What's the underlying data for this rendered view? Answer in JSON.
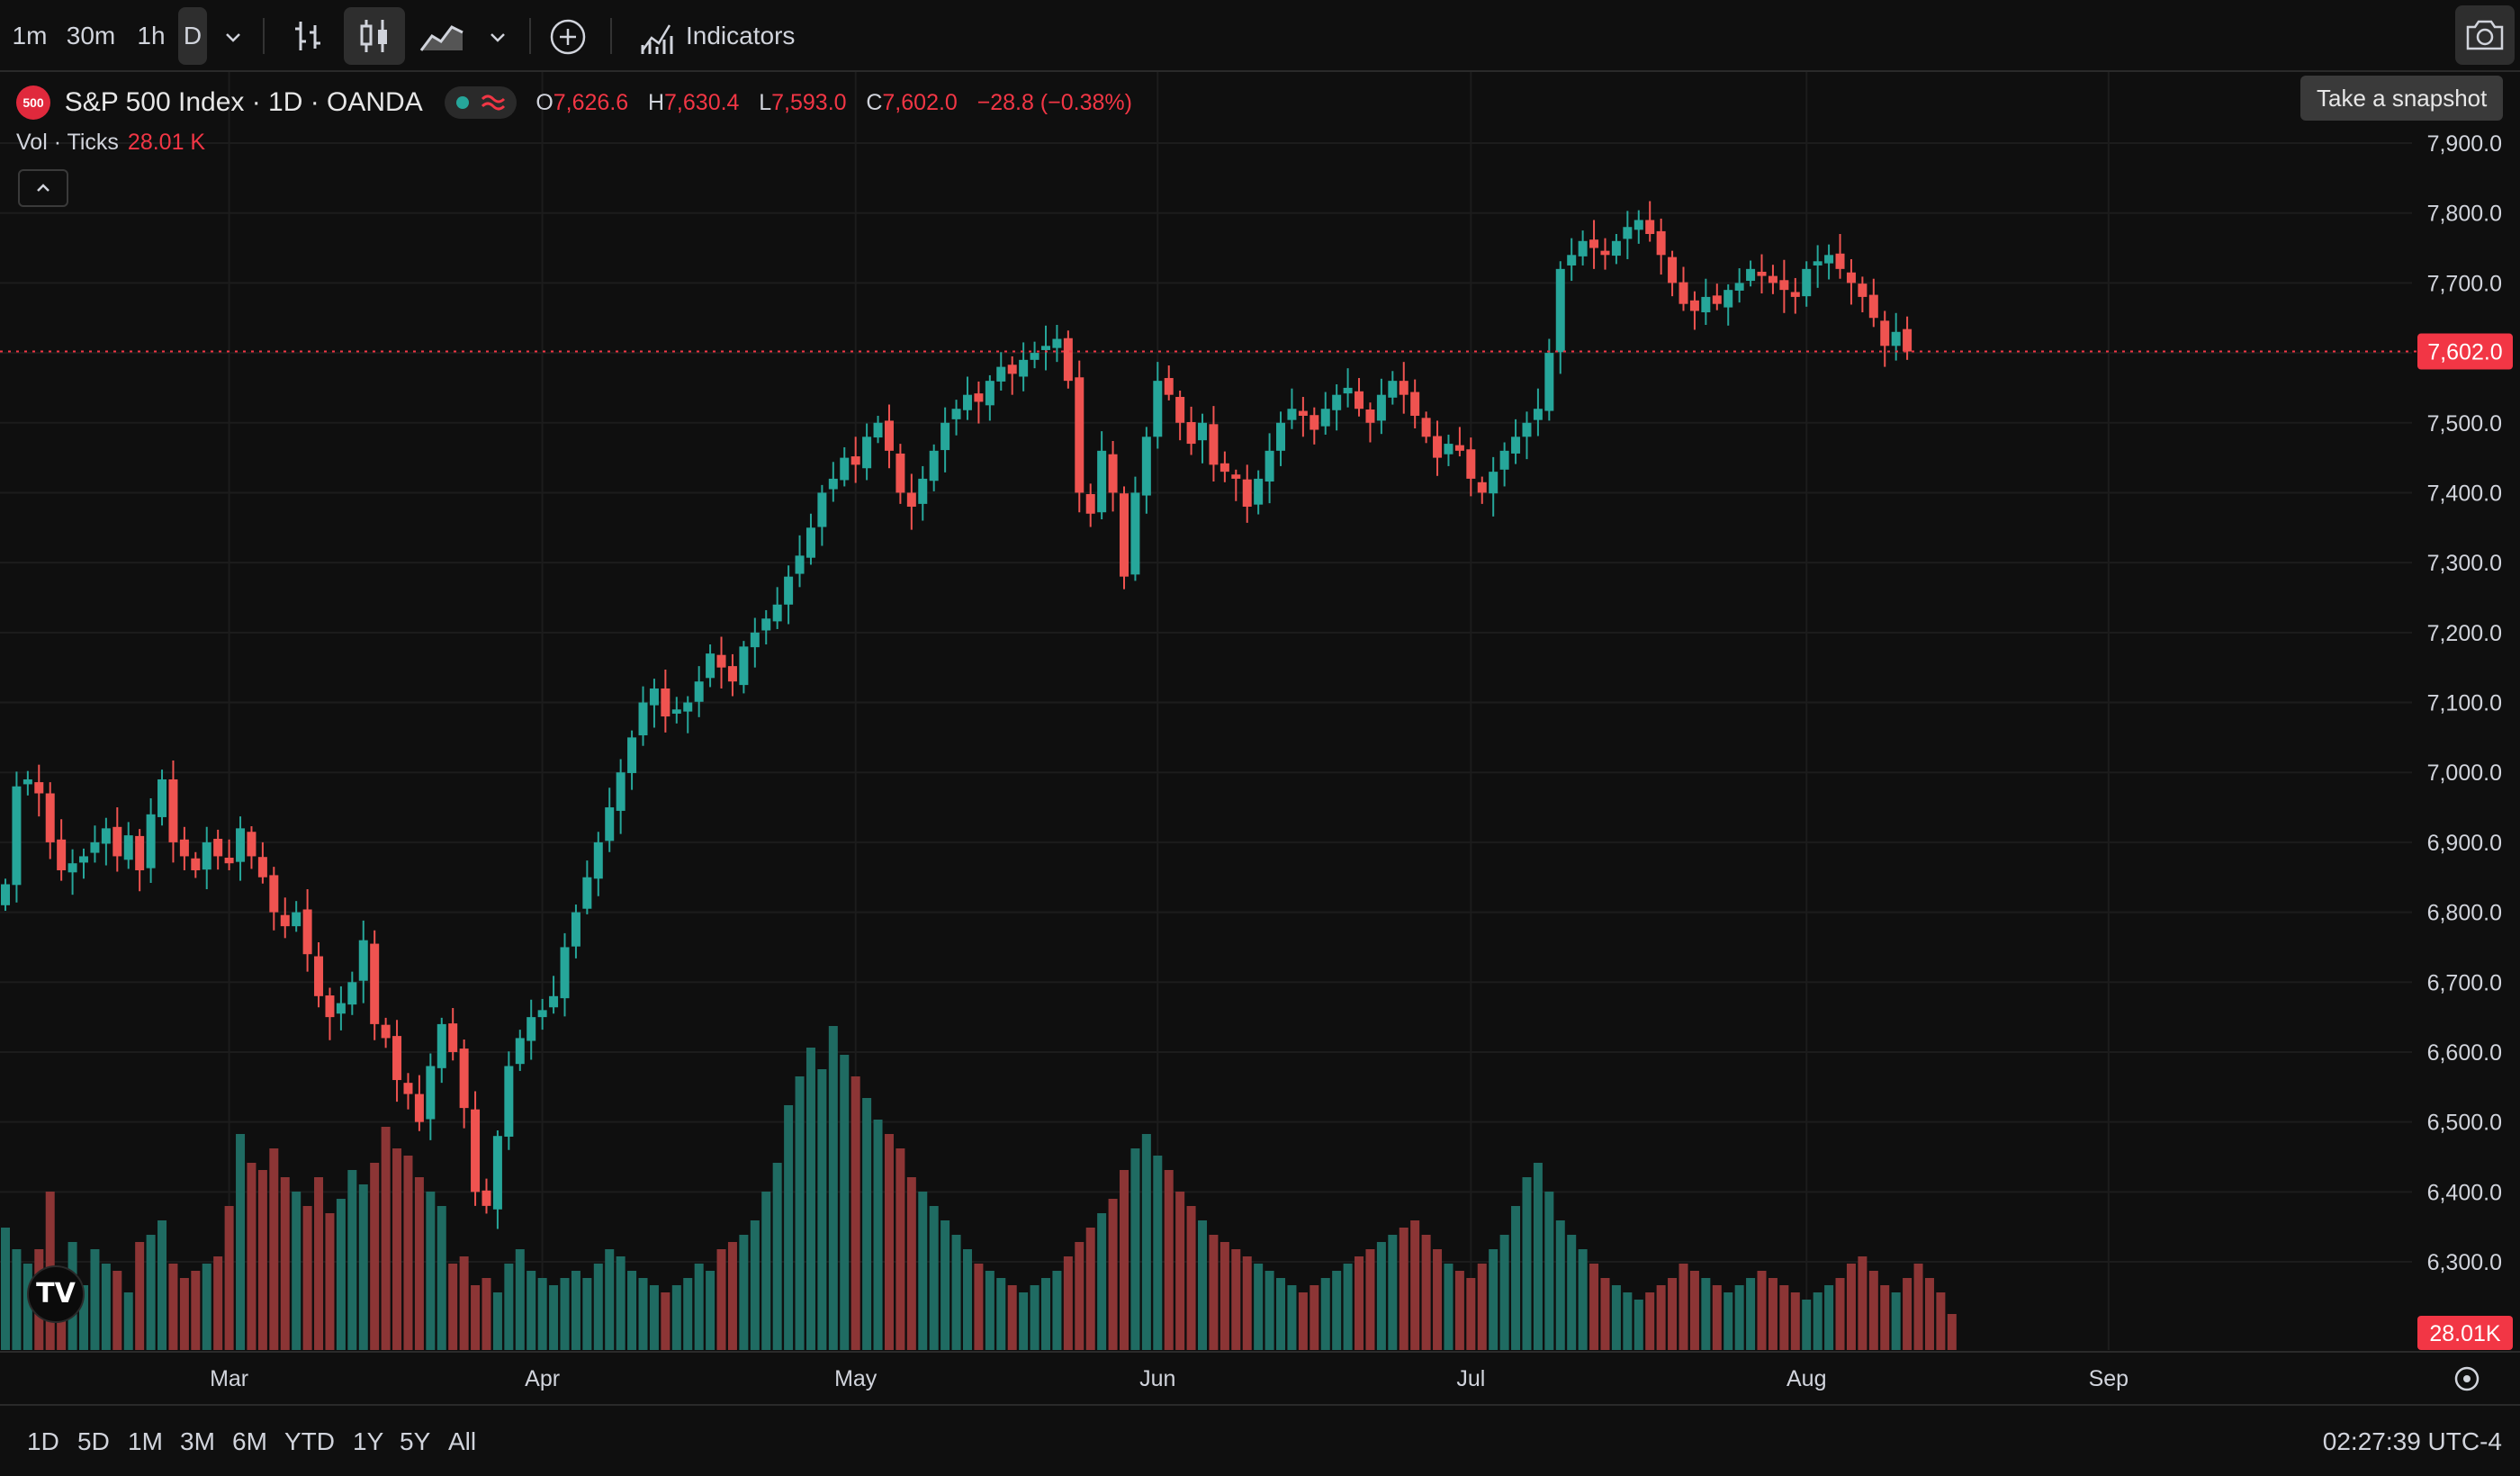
{
  "toolbar": {
    "intervals": [
      "1m",
      "30m",
      "1h",
      "D"
    ],
    "active_interval": "D",
    "indicators_label": "Indicators",
    "snapshot_tooltip": "Take a snapshot"
  },
  "legend": {
    "logo_text": "500",
    "title": "S&P 500 Index · 1D · OANDA",
    "o_key": "O",
    "o_val": "7,626.6",
    "h_key": "H",
    "h_val": "7,630.4",
    "l_key": "L",
    "l_val": "7,593.0",
    "c_key": "C",
    "c_val": "7,602.0",
    "change": "−28.8 (−0.38%)",
    "vol_label": "Vol · Ticks",
    "vol_value": "28.01 K"
  },
  "bottom": {
    "ranges": [
      "1D",
      "5D",
      "1M",
      "3M",
      "6M",
      "YTD",
      "1Y",
      "5Y",
      "All"
    ],
    "clock": "02:27:39 UTC-4"
  },
  "colors": {
    "up": "#26a69a",
    "down": "#ef5350",
    "up_vol": "#1f6b62",
    "down_vol": "#8c3535",
    "last_price": "#f23645"
  },
  "chart_data": {
    "type": "candlestick",
    "title": "S&P 500 Index · 1D · OANDA",
    "y_ticks": [
      "6,300.0",
      "6,400.0",
      "6,500.0",
      "6,600.0",
      "6,700.0",
      "6,800.0",
      "6,900.0",
      "7,000.0",
      "7,100.0",
      "7,200.0",
      "7,300.0",
      "7,400.0",
      "7,500.0",
      "7,600.0",
      "7,700.0",
      "7,800.0",
      "7,900.0"
    ],
    "y_tick_values": [
      6300,
      6400,
      6500,
      6600,
      6700,
      6800,
      6900,
      7000,
      7100,
      7200,
      7300,
      7400,
      7500,
      7600,
      7700,
      7800,
      7900
    ],
    "x_ticks": [
      {
        "label": "Mar",
        "index": 20
      },
      {
        "label": "Apr",
        "index": 48
      },
      {
        "label": "May",
        "index": 76
      },
      {
        "label": "Jun",
        "index": 103
      },
      {
        "label": "Jul",
        "index": 131
      },
      {
        "label": "Aug",
        "index": 161
      },
      {
        "label": "Sep",
        "index": 188
      }
    ],
    "last_price_label": "7,602.0",
    "last_price": 7602,
    "last_volume_label": "28.01K",
    "closes": [
      6840,
      6980,
      6990,
      6970,
      6900,
      6860,
      6870,
      6880,
      6900,
      6920,
      6880,
      6910,
      6860,
      6940,
      6990,
      6900,
      6880,
      6860,
      6900,
      6880,
      6870,
      6920,
      6880,
      6850,
      6800,
      6780,
      6800,
      6740,
      6680,
      6650,
      6670,
      6700,
      6760,
      6640,
      6620,
      6560,
      6540,
      6500,
      6580,
      6640,
      6600,
      6520,
      6400,
      6380,
      6480,
      6580,
      6620,
      6650,
      6660,
      6680,
      6750,
      6800,
      6850,
      6900,
      6950,
      7000,
      7050,
      7100,
      7120,
      7080,
      7090,
      7100,
      7130,
      7170,
      7150,
      7130,
      7180,
      7200,
      7220,
      7240,
      7280,
      7310,
      7350,
      7400,
      7420,
      7450,
      7440,
      7480,
      7500,
      7460,
      7400,
      7380,
      7420,
      7460,
      7500,
      7520,
      7540,
      7530,
      7560,
      7580,
      7570,
      7590,
      7600,
      7610,
      7620,
      7560,
      7400,
      7370,
      7460,
      7400,
      7280,
      7400,
      7480,
      7560,
      7540,
      7500,
      7470,
      7500,
      7440,
      7430,
      7420,
      7380,
      7420,
      7460,
      7500,
      7520,
      7510,
      7490,
      7520,
      7540,
      7550,
      7520,
      7500,
      7540,
      7560,
      7540,
      7510,
      7480,
      7450,
      7470,
      7460,
      7420,
      7400,
      7430,
      7460,
      7480,
      7500,
      7520,
      7600,
      7720,
      7740,
      7760,
      7750,
      7740,
      7760,
      7780,
      7790,
      7770,
      7740,
      7700,
      7670,
      7660,
      7680,
      7670,
      7690,
      7700,
      7720,
      7710,
      7700,
      7690,
      7680,
      7720,
      7730,
      7740,
      7720,
      7700,
      7680,
      7650,
      7610,
      7630,
      7602
    ],
    "volumes": [
      17000,
      14000,
      12000,
      14000,
      22000,
      10000,
      15000,
      9000,
      14000,
      12000,
      11000,
      8000,
      15000,
      16000,
      18000,
      12000,
      10000,
      11000,
      12000,
      13000,
      20000,
      30000,
      26000,
      25000,
      28000,
      24000,
      22000,
      20000,
      24000,
      19000,
      21000,
      25000,
      23000,
      26000,
      31000,
      28000,
      27000,
      24000,
      22000,
      20000,
      12000,
      13000,
      9000,
      10000,
      8000,
      12000,
      14000,
      11000,
      10000,
      9000,
      10000,
      11000,
      10000,
      12000,
      14000,
      13000,
      11000,
      10000,
      9000,
      8000,
      9000,
      10000,
      12000,
      11000,
      14000,
      15000,
      16000,
      18000,
      22000,
      26000,
      34000,
      38000,
      42000,
      39000,
      45000,
      41000,
      38000,
      35000,
      32000,
      30000,
      28000,
      24000,
      22000,
      20000,
      18000,
      16000,
      14000,
      12000,
      11000,
      10000,
      9000,
      8000,
      9000,
      10000,
      11000,
      13000,
      15000,
      17000,
      19000,
      21000,
      25000,
      28000,
      30000,
      27000,
      25000,
      22000,
      20000,
      18000,
      16000,
      15000,
      14000,
      13000,
      12000,
      11000,
      10000,
      9000,
      8000,
      9000,
      10000,
      11000,
      12000,
      13000,
      14000,
      15000,
      16000,
      17000,
      18000,
      16000,
      14000,
      12000,
      11000,
      10000,
      12000,
      14000,
      16000,
      20000,
      24000,
      26000,
      22000,
      18000,
      16000,
      14000,
      12000,
      10000,
      9000,
      8000,
      7000,
      8000,
      9000,
      10000,
      12000,
      11000,
      10000,
      9000,
      8000,
      9000,
      10000,
      11000,
      10000,
      9000,
      8000,
      7000,
      8000,
      9000,
      10000,
      12000,
      13000,
      11000,
      9000,
      8000,
      10000,
      12000,
      10000,
      8000,
      5000
    ]
  }
}
